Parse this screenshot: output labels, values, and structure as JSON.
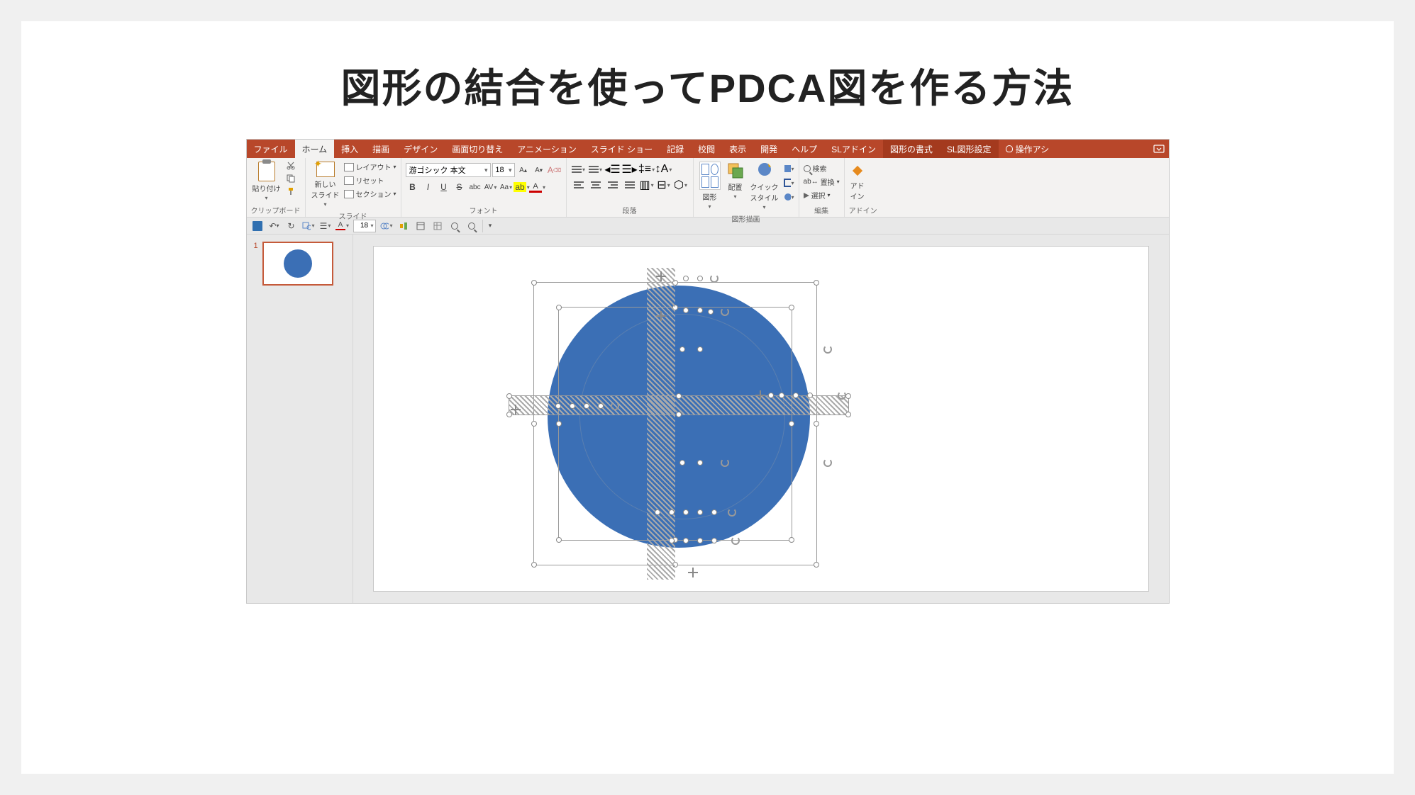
{
  "title": "図形の結合を使ってPDCA図を作る方法",
  "tabs": {
    "file": "ファイル",
    "home": "ホーム",
    "insert": "挿入",
    "draw": "描画",
    "design": "デザイン",
    "transitions": "画面切り替え",
    "animations": "アニメーション",
    "slideshow": "スライド ショー",
    "record": "記録",
    "review": "校閲",
    "view": "表示",
    "developer": "開発",
    "help": "ヘルプ",
    "sladdin": "SLアドイン",
    "shape_format": "図形の書式",
    "sl_shape": "SL図形設定",
    "tell_me": "操作アシ"
  },
  "ribbon": {
    "clipboard": {
      "label": "クリップボード",
      "paste": "貼り付け"
    },
    "slides": {
      "label": "スライド",
      "new_slide": "新しい\nスライド",
      "layout": "レイアウト",
      "reset": "リセット",
      "section": "セクション"
    },
    "font": {
      "label": "フォント",
      "name": "游ゴシック 本文",
      "size": "18"
    },
    "paragraph": {
      "label": "段落"
    },
    "drawing": {
      "label": "図形描画",
      "shapes": "図形",
      "arrange": "配置",
      "quick_styles": "クイック\nスタイル"
    },
    "editing": {
      "label": "編集",
      "find": "検索",
      "replace": "置換",
      "select": "選択"
    },
    "addin": {
      "label": "アドイン",
      "btn": "アド\nイン"
    }
  },
  "qat": {
    "font_size": "18"
  },
  "thumb": {
    "num": "1"
  }
}
